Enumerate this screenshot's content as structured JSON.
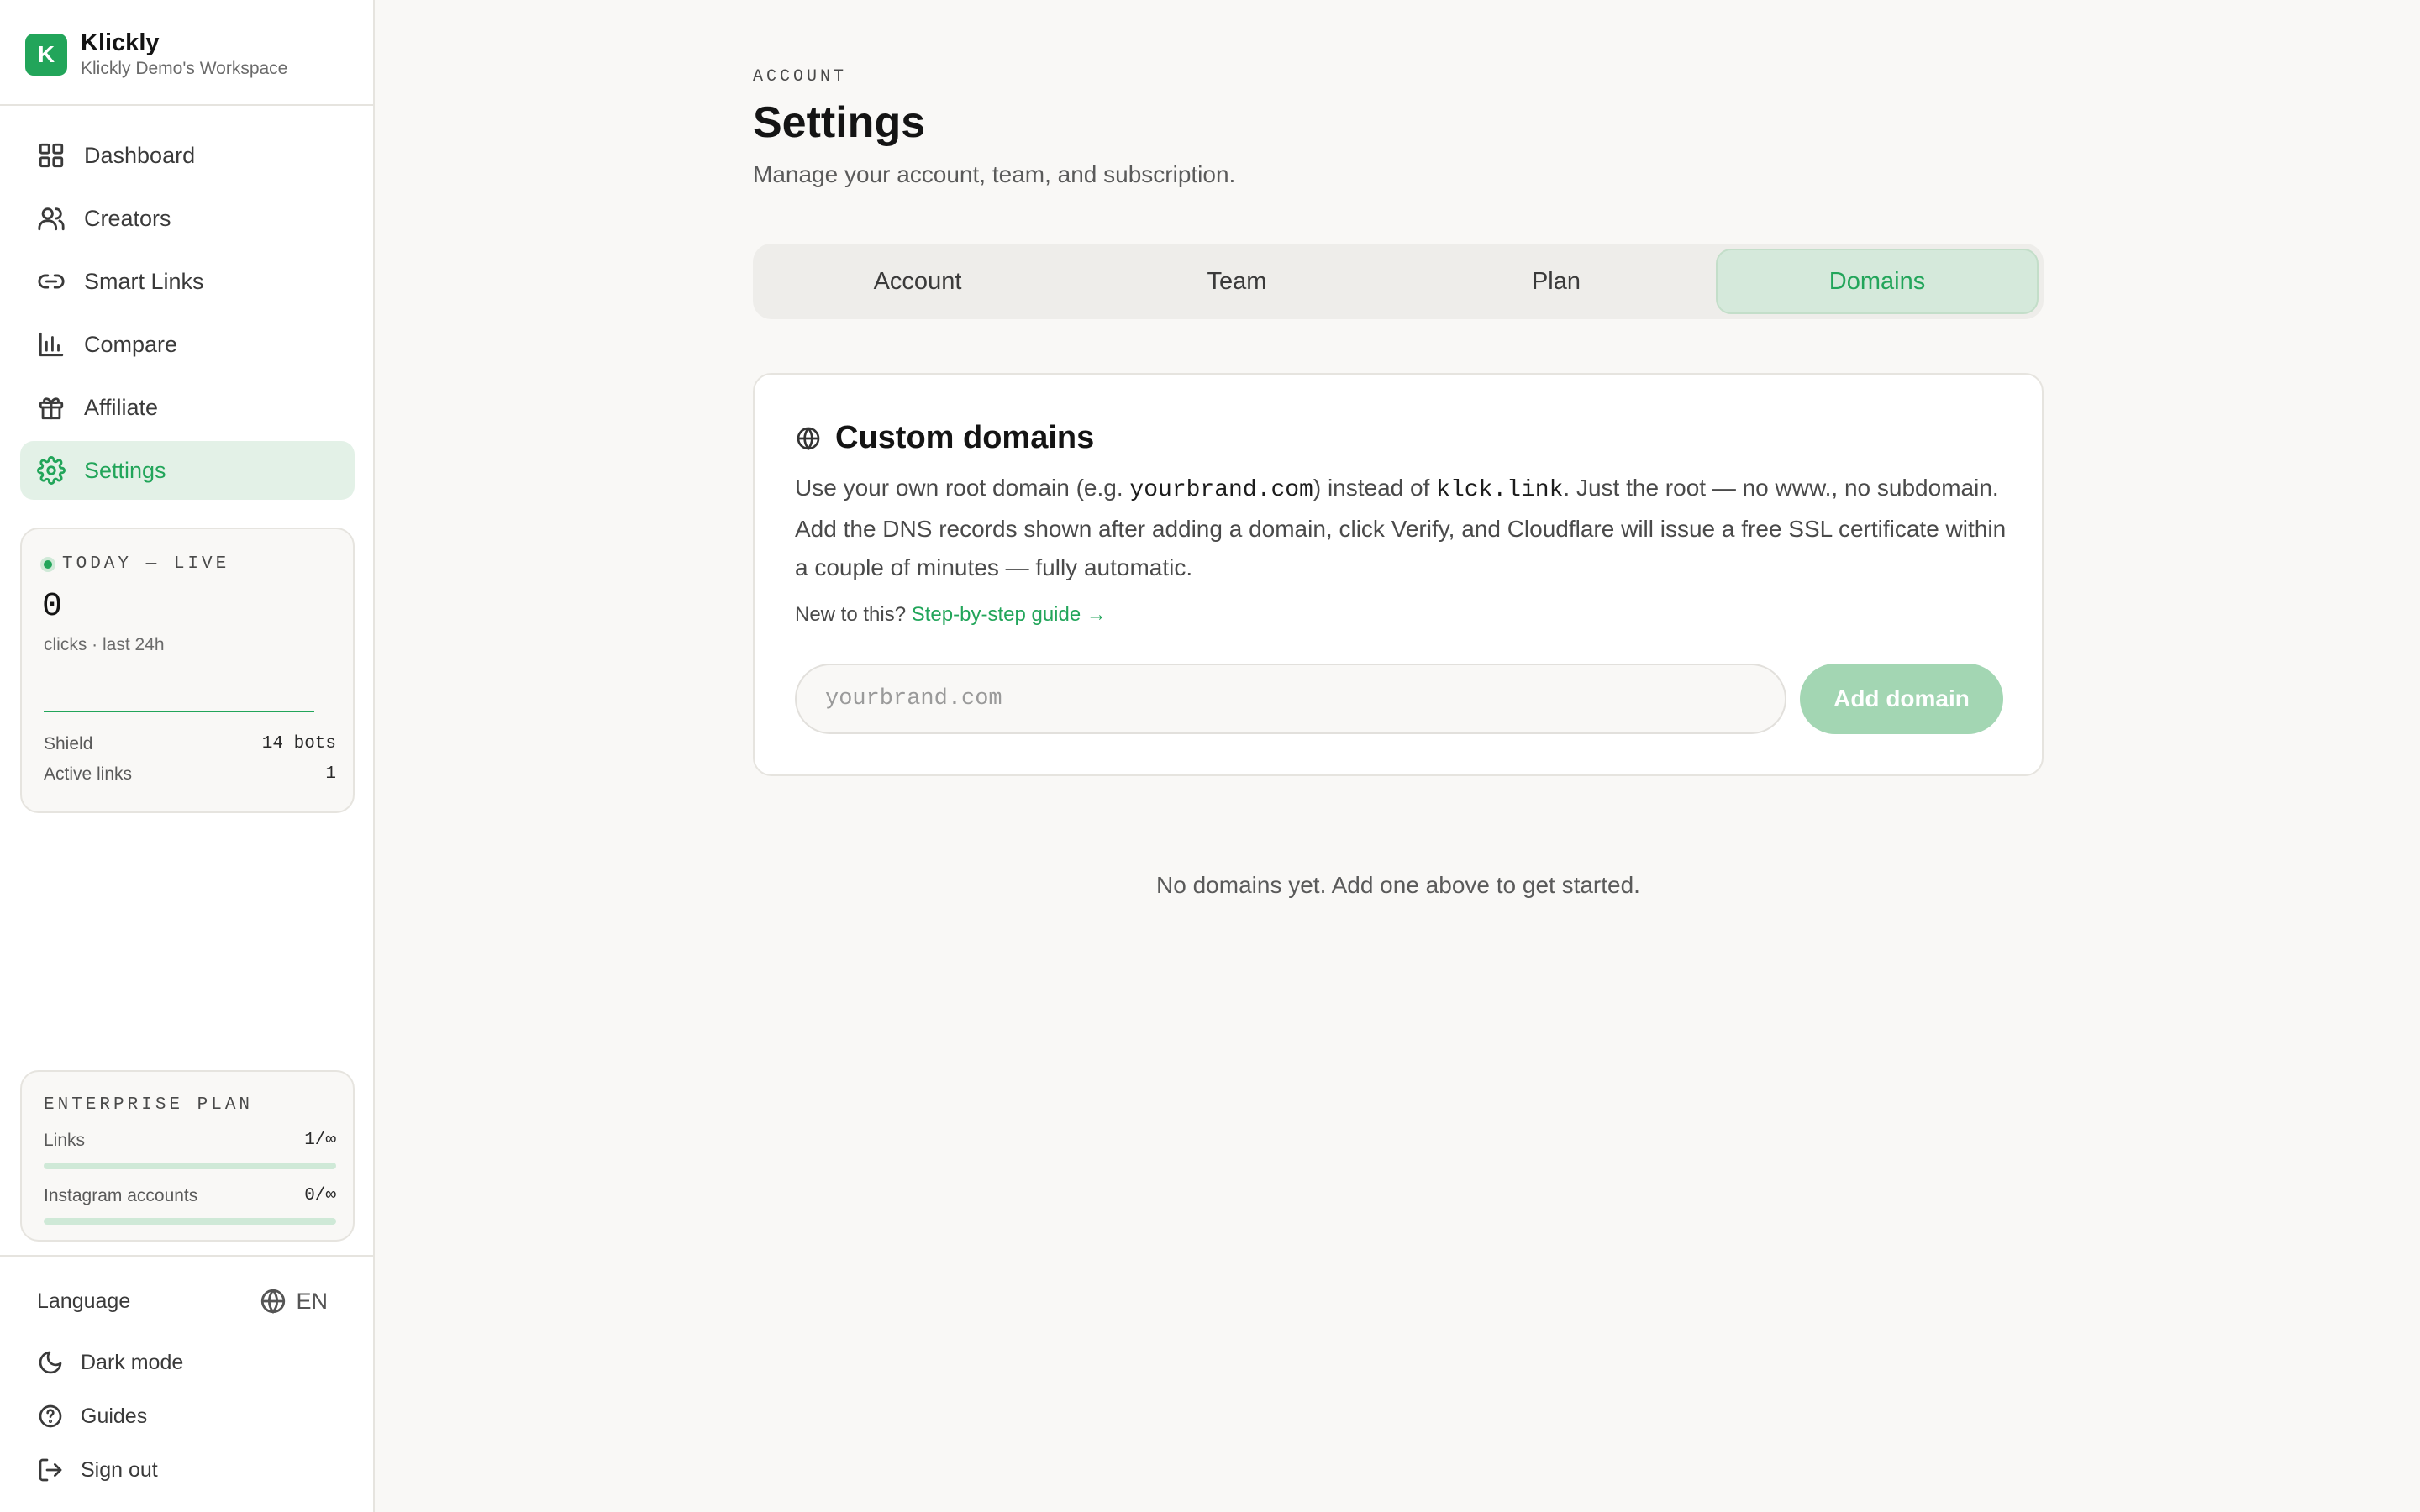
{
  "brand": {
    "logo_letter": "K",
    "name": "Klickly",
    "workspace": "Klickly Demo's Workspace",
    "accent": "#22a55a"
  },
  "nav": [
    {
      "label": "Dashboard",
      "icon": "grid-icon",
      "active": false
    },
    {
      "label": "Creators",
      "icon": "users-icon",
      "active": false
    },
    {
      "label": "Smart Links",
      "icon": "link-icon",
      "active": false
    },
    {
      "label": "Compare",
      "icon": "bar-chart-icon",
      "active": false
    },
    {
      "label": "Affiliate",
      "icon": "gift-icon",
      "active": false
    },
    {
      "label": "Settings",
      "icon": "gear-icon",
      "active": true
    }
  ],
  "live": {
    "label": "TODAY — LIVE",
    "count": "0",
    "sub": "clicks · last 24h",
    "shield_label": "Shield",
    "shield_value": "14 bots",
    "active_links_label": "Active links",
    "active_links_value": "1"
  },
  "plan": {
    "title": "ENTERPRISE PLAN",
    "links_label": "Links",
    "links_value": "1/∞",
    "instagram_label": "Instagram accounts",
    "instagram_value": "0/∞"
  },
  "footer": {
    "language_label": "Language",
    "language_value": "EN",
    "dark_mode": "Dark mode",
    "guides": "Guides",
    "sign_out": "Sign out"
  },
  "header": {
    "eyebrow": "ACCOUNT",
    "title": "Settings",
    "subtitle": "Manage your account, team, and subscription."
  },
  "tabs": [
    {
      "label": "Account",
      "active": false
    },
    {
      "label": "Team",
      "active": false
    },
    {
      "label": "Plan",
      "active": false
    },
    {
      "label": "Domains",
      "active": true
    }
  ],
  "custom_domains": {
    "title": "Custom domains",
    "desc_1": "Use your own root domain (e.g. ",
    "desc_code_1": "yourbrand.com",
    "desc_2": ") instead of ",
    "desc_code_2": "klck.link",
    "desc_3": ". Just the root — no www., no subdomain. Add the DNS records shown after adding a domain, click Verify, and Cloudflare will issue a free SSL certificate within a couple of minutes — fully automatic.",
    "guide_prefix": "New to this?",
    "guide_link": "Step-by-step guide →",
    "input_placeholder": "yourbrand.com",
    "input_value": "",
    "add_button": "Add domain"
  },
  "empty_state": "No domains yet. Add one above to get started."
}
